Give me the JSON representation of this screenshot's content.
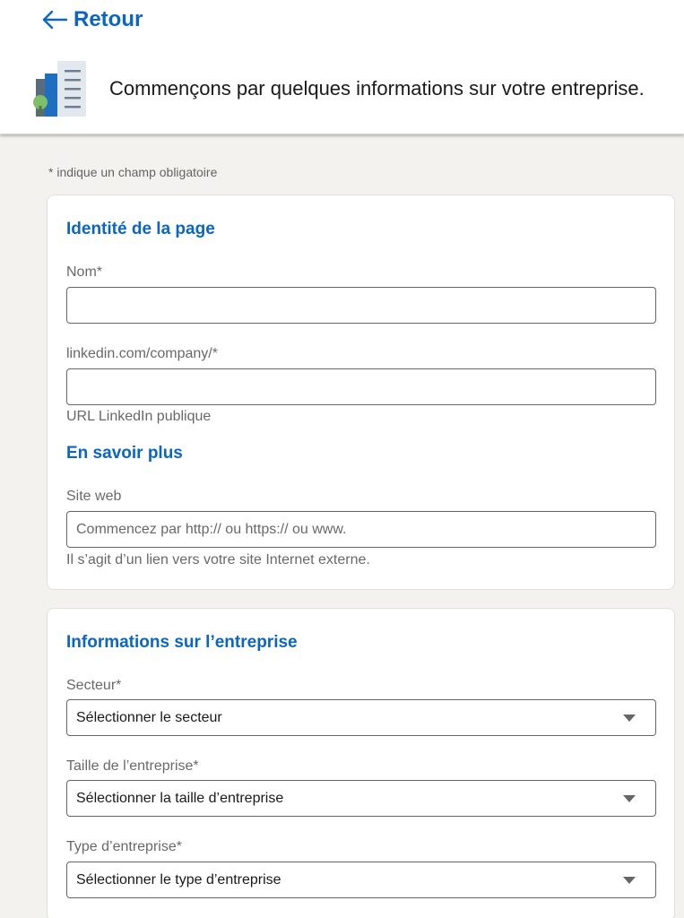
{
  "header": {
    "back_label": "Retour",
    "intro_text": "Commençons par quelques informations sur votre entreprise."
  },
  "required_note": "*  indique un champ obligatoire",
  "page_identity": {
    "title": "Identité de la page",
    "name_label": "Nom*",
    "name_value": "",
    "url_label": "linkedin.com/company/*",
    "url_value": "",
    "url_hint": "URL LinkedIn publique"
  },
  "learn_more": {
    "title": "En savoir plus",
    "website_label": "Site web",
    "website_placeholder": "Commencez par http:// ou https:// ou www.",
    "website_hint": "Il s’agit d’un lien vers votre site Internet externe."
  },
  "company_info": {
    "title": "Informations sur l’entreprise",
    "sector_label": "Secteur*",
    "sector_value": "Sélectionner le secteur",
    "size_label": "Taille de l’entreprise*",
    "size_value": "Sélectionner la taille d’entreprise",
    "type_label": "Type d’entreprise*",
    "type_value": "Sélectionner le type d’entreprise"
  },
  "colors": {
    "accent": "#0a66c2",
    "background": "#f3f2ef",
    "card": "#ffffff"
  }
}
